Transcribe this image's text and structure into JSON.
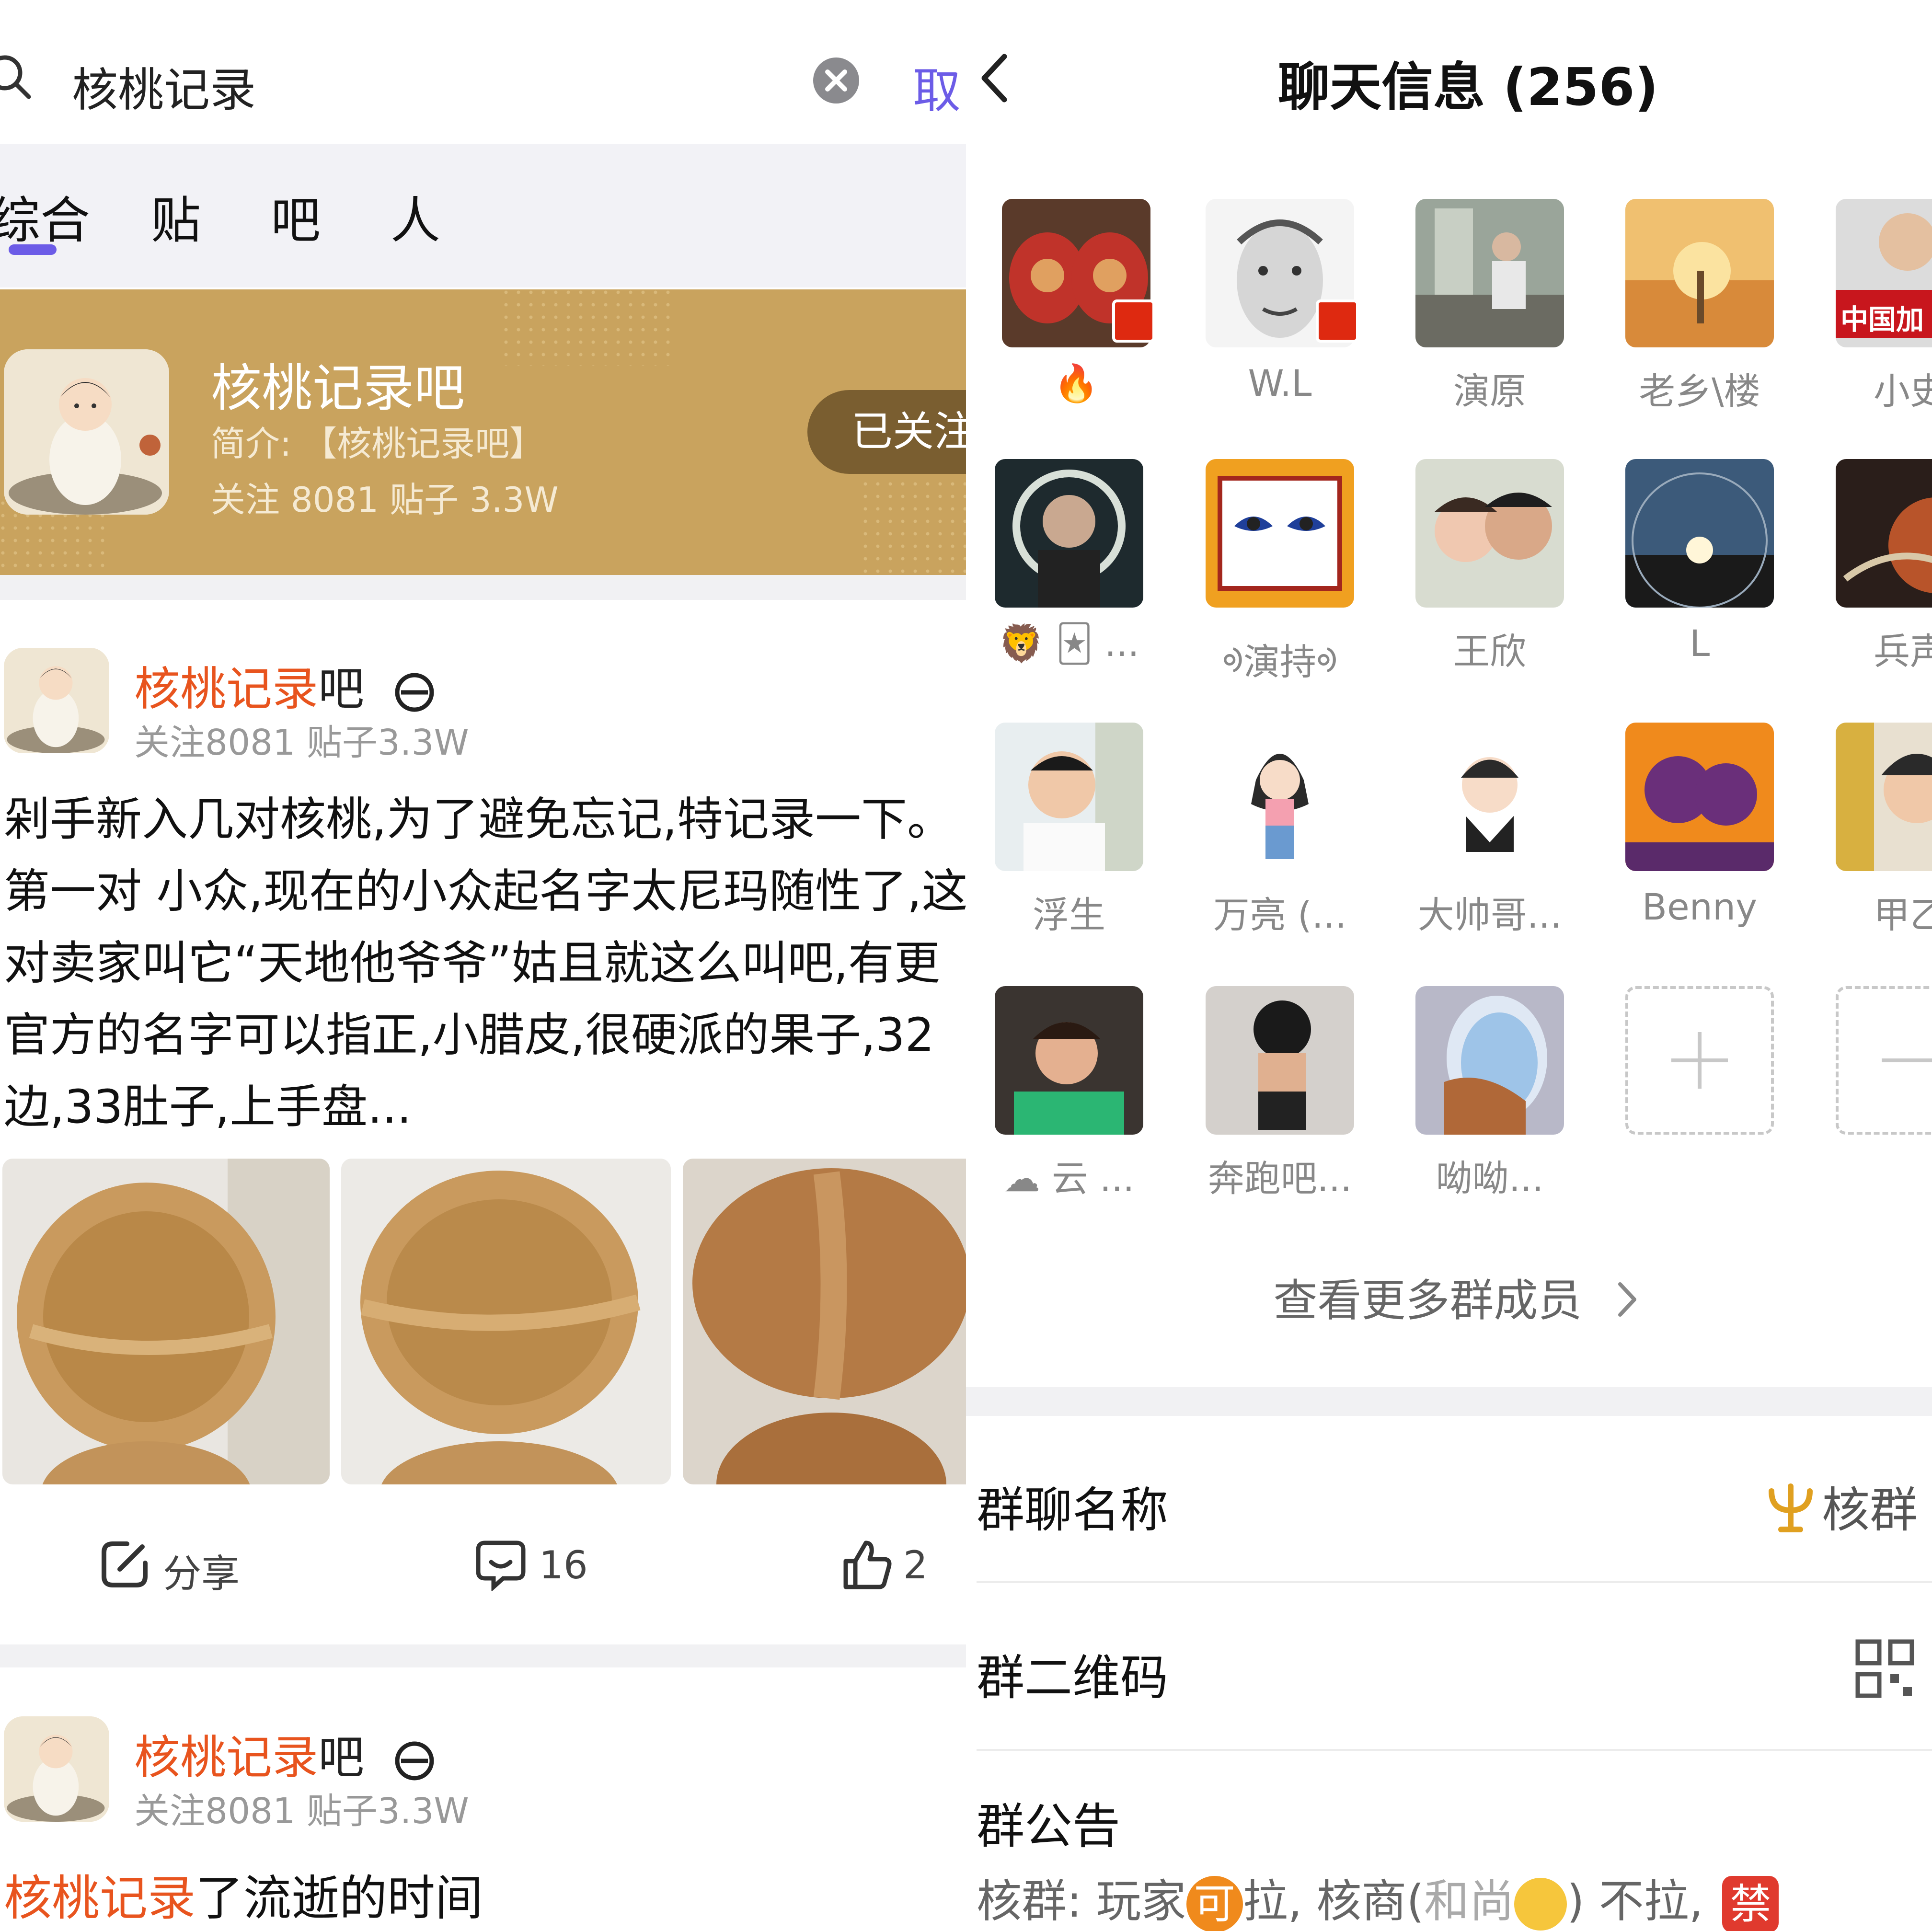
{
  "left": {
    "search": {
      "query": "核桃记录",
      "cancel_label": "取"
    },
    "tabs": [
      {
        "label": "综合"
      },
      {
        "label": "贴"
      },
      {
        "label": "吧"
      },
      {
        "label": "人"
      }
    ],
    "forum_card": {
      "name": "核桃记录吧",
      "intro": "简介: 【核桃记录吧】",
      "stats": "关注 8081    贴子 3.3W",
      "follow_label": "已关注"
    },
    "posts": [
      {
        "forum_hl": "核桃记录",
        "forum_rest": "吧",
        "meta": "关注8081    贴子3.3W",
        "lines": [
          "剁手新入几对核桃,为了避免忘记,特记录一下。",
          "第一对 小众,现在的小众起名字太尼玛随性了,这",
          "对卖家叫它“天地他爷爷”姑且就这么叫吧,有更",
          "官方的名字可以指正,小腊皮,很硬派的果子,32",
          "边,33肚子,上手盘..."
        ],
        "share_label": "分享",
        "comment_count": "16",
        "like_count": "2"
      },
      {
        "forum_hl": "核桃记录",
        "forum_rest": "吧",
        "meta": "关注8081    贴子3.3W",
        "title_hl": "核桃记录",
        "title_rest": "了流逝的时间"
      }
    ]
  },
  "right": {
    "title": "聊天信息 (256)",
    "members": [
      {
        "name": "🔥"
      },
      {
        "name": "W.L"
      },
      {
        "name": "演原"
      },
      {
        "name": "老乡\\楼"
      },
      {
        "name": "小史"
      },
      {
        "name": "🦁 🃏 ..."
      },
      {
        "name": "ᢀ演持ᢀ"
      },
      {
        "name": "王欣"
      },
      {
        "name": "L"
      },
      {
        "name": "兵声"
      },
      {
        "name": "浮生"
      },
      {
        "name": "万亮 (..."
      },
      {
        "name": "大帅哥..."
      },
      {
        "name": "Benny"
      },
      {
        "name": "甲乙"
      },
      {
        "name": "☁ 云 ..."
      },
      {
        "name": "奔跑吧..."
      },
      {
        "name": "呦呦..."
      }
    ],
    "avatar_badge_text": "中国加",
    "see_more": "查看更多群成员",
    "group_name_label": "群聊名称",
    "group_name_value": "核群",
    "qr_label": "群二维码",
    "notice_label": "群公告",
    "notice_text_1": "核群: 玩家",
    "notice_badge_1": "可",
    "notice_text_2": "拉, 核商(",
    "notice_text_3": "和尚",
    "notice_text_4": ") 不拉,",
    "notice_badge_2": "禁",
    "colors": {
      "accent": "#6c5ce7",
      "forum_card": "#c9a35e",
      "highlight": "#e8541e"
    }
  }
}
